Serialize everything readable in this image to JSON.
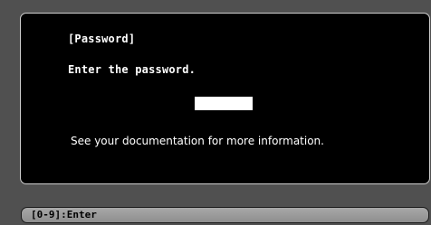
{
  "dialog": {
    "title": "[Password]",
    "prompt": "Enter the password.",
    "password_value": "",
    "info": "See your documentation for more information."
  },
  "help_bar": {
    "text": "[0-9]:Enter"
  },
  "colors": {
    "background": "#4a4a4a",
    "dialog_background": "#000000",
    "dialog_border": "#cfcfcf",
    "text": "#ffffff",
    "input_background": "#ffffff",
    "help_bar_background": "#9a9a9a"
  }
}
